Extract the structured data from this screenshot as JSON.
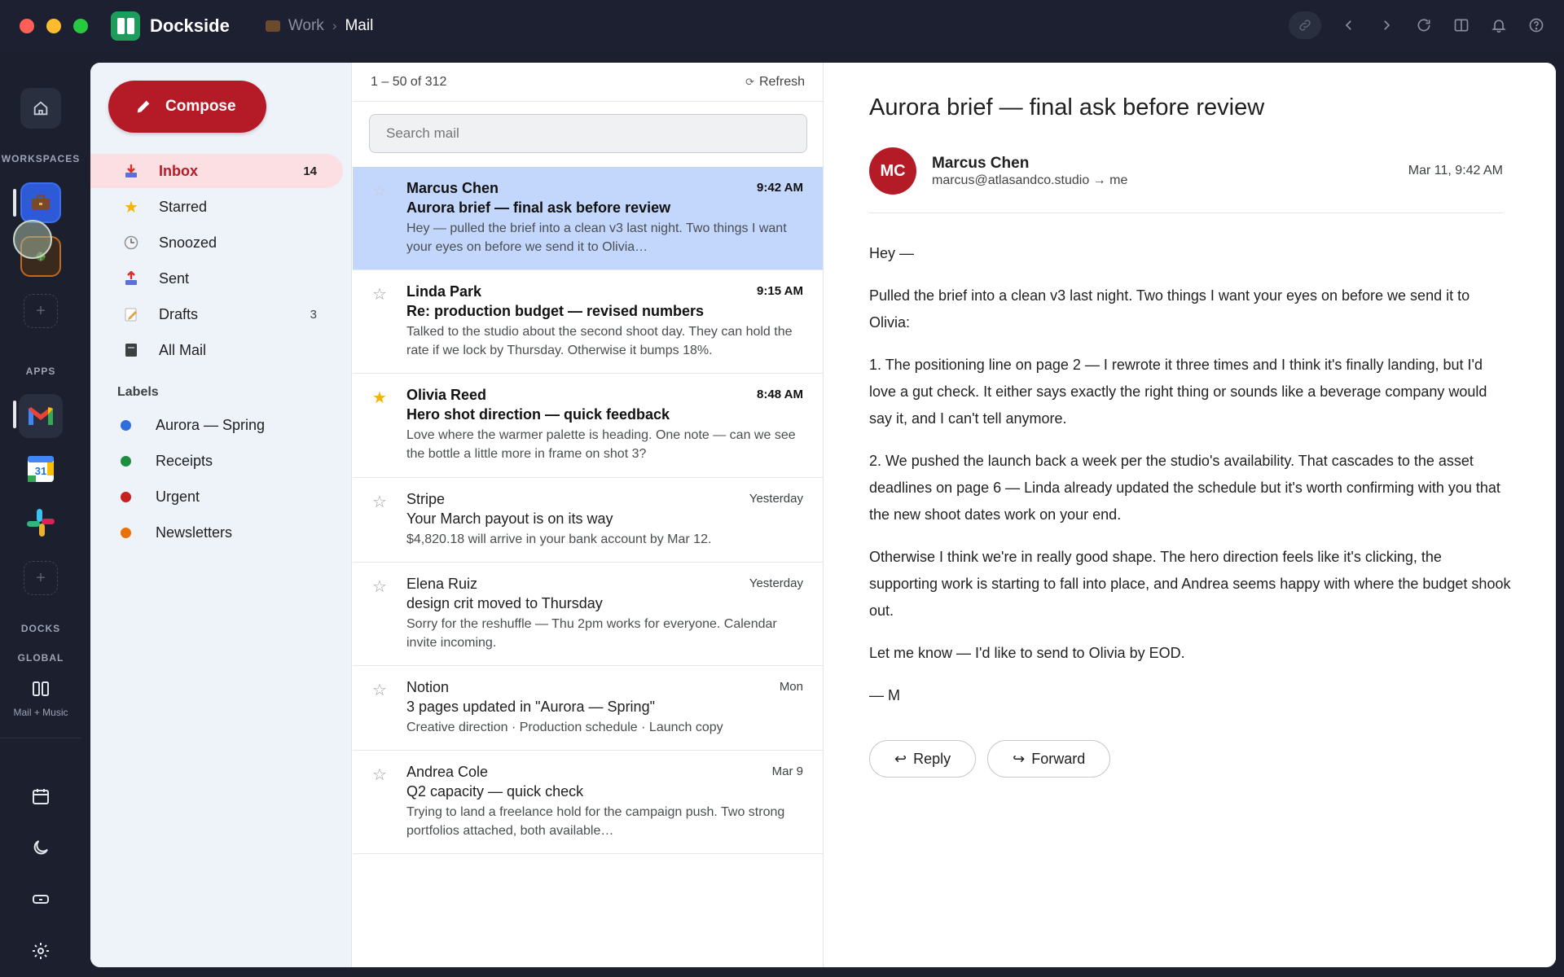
{
  "app": {
    "name": "Dockside"
  },
  "breadcrumb": {
    "workspace": "Work",
    "separator": "›",
    "current": "Mail"
  },
  "rail": {
    "workspaces_label": "WORKSPACES",
    "apps_label": "APPS",
    "docks_label": "DOCKS",
    "global_label": "GLOBAL",
    "dock_name": "Mail + Music",
    "calendar_day": "31"
  },
  "compose_label": "Compose",
  "nav": [
    {
      "label": "Inbox",
      "count": "14",
      "icon": "inbox-icon"
    },
    {
      "label": "Starred",
      "count": "",
      "icon": "star-icon"
    },
    {
      "label": "Snoozed",
      "count": "",
      "icon": "clock-icon"
    },
    {
      "label": "Sent",
      "count": "",
      "icon": "sent-icon"
    },
    {
      "label": "Drafts",
      "count": "3",
      "icon": "draft-icon"
    },
    {
      "label": "All Mail",
      "count": "",
      "icon": "archive-icon"
    }
  ],
  "labels_heading": "Labels",
  "labels": [
    {
      "name": "Aurora — Spring",
      "color": "#2f6fdb"
    },
    {
      "name": "Receipts",
      "color": "#1e8e3e"
    },
    {
      "name": "Urgent",
      "color": "#c5221f"
    },
    {
      "name": "Newsletters",
      "color": "#e8710a"
    }
  ],
  "list": {
    "range": "1 – 50 of 312",
    "refresh": "Refresh",
    "search_placeholder": "Search mail"
  },
  "messages": [
    {
      "from": "Marcus Chen",
      "time": "9:42 AM",
      "subject": "Aurora brief — final ask before review",
      "snippet": "Hey — pulled the brief into a clean v3 last night. Two things I want your eyes on before we send it to Olivia…",
      "unread": true,
      "starred": false,
      "selected": true
    },
    {
      "from": "Linda Park",
      "time": "9:15 AM",
      "subject": "Re: production budget — revised numbers",
      "snippet": "Talked to the studio about the second shoot day. They can hold the rate if we lock by Thursday. Otherwise it bumps 18%.",
      "unread": true,
      "starred": false,
      "selected": false
    },
    {
      "from": "Olivia Reed",
      "time": "8:48 AM",
      "subject": "Hero shot direction — quick feedback",
      "snippet": "Love where the warmer palette is heading. One note — can we see the bottle a little more in frame on shot 3?",
      "unread": true,
      "starred": true,
      "selected": false
    },
    {
      "from": "Stripe",
      "time": "Yesterday",
      "subject": "Your March payout is on its way",
      "snippet": "$4,820.18 will arrive in your bank account by Mar 12.",
      "unread": false,
      "starred": false,
      "selected": false
    },
    {
      "from": "Elena Ruiz",
      "time": "Yesterday",
      "subject": "design crit moved to Thursday",
      "snippet": "Sorry for the reshuffle — Thu 2pm works for everyone. Calendar invite incoming.",
      "unread": false,
      "starred": false,
      "selected": false
    },
    {
      "from": "Notion",
      "time": "Mon",
      "subject": "3 pages updated in \"Aurora — Spring\"",
      "snippet": "Creative direction · Production schedule · Launch copy",
      "unread": false,
      "starred": false,
      "selected": false
    },
    {
      "from": "Andrea Cole",
      "time": "Mar 9",
      "subject": "Q2 capacity — quick check",
      "snippet": "Trying to land a freelance hold for the campaign push. Two strong portfolios attached, both available…",
      "unread": false,
      "starred": false,
      "selected": false
    }
  ],
  "reader": {
    "subject": "Aurora brief — final ask before review",
    "avatar_initials": "MC",
    "sender_name": "Marcus Chen",
    "sender_line": "marcus@atlasandco.studio → me",
    "date": "Mar 11, 9:42 AM",
    "paragraphs": [
      "Hey —",
      "Pulled the brief into a clean v3 last night. Two things I want your eyes on before we send it to Olivia:",
      "1. The positioning line on page 2 — I rewrote it three times and I think it's finally landing, but I'd love a gut check. It either says exactly the right thing or sounds like a beverage company would say it, and I can't tell anymore.",
      "2. We pushed the launch back a week per the studio's availability. That cascades to the asset deadlines on page 6 — Linda already updated the schedule but it's worth confirming with you that the new shoot dates work on your end.",
      "Otherwise I think we're in really good shape. The hero direction feels like it's clicking, the supporting work is starting to fall into place, and Andrea seems happy with where the budget shook out.",
      "Let me know — I'd like to send to Olivia by EOD.",
      "— M"
    ],
    "reply_label": "Reply",
    "forward_label": "Forward"
  },
  "colors": {
    "accent": "#b51b27",
    "selected_row": "#c2d7fb",
    "rail": "#1b1f2e"
  }
}
